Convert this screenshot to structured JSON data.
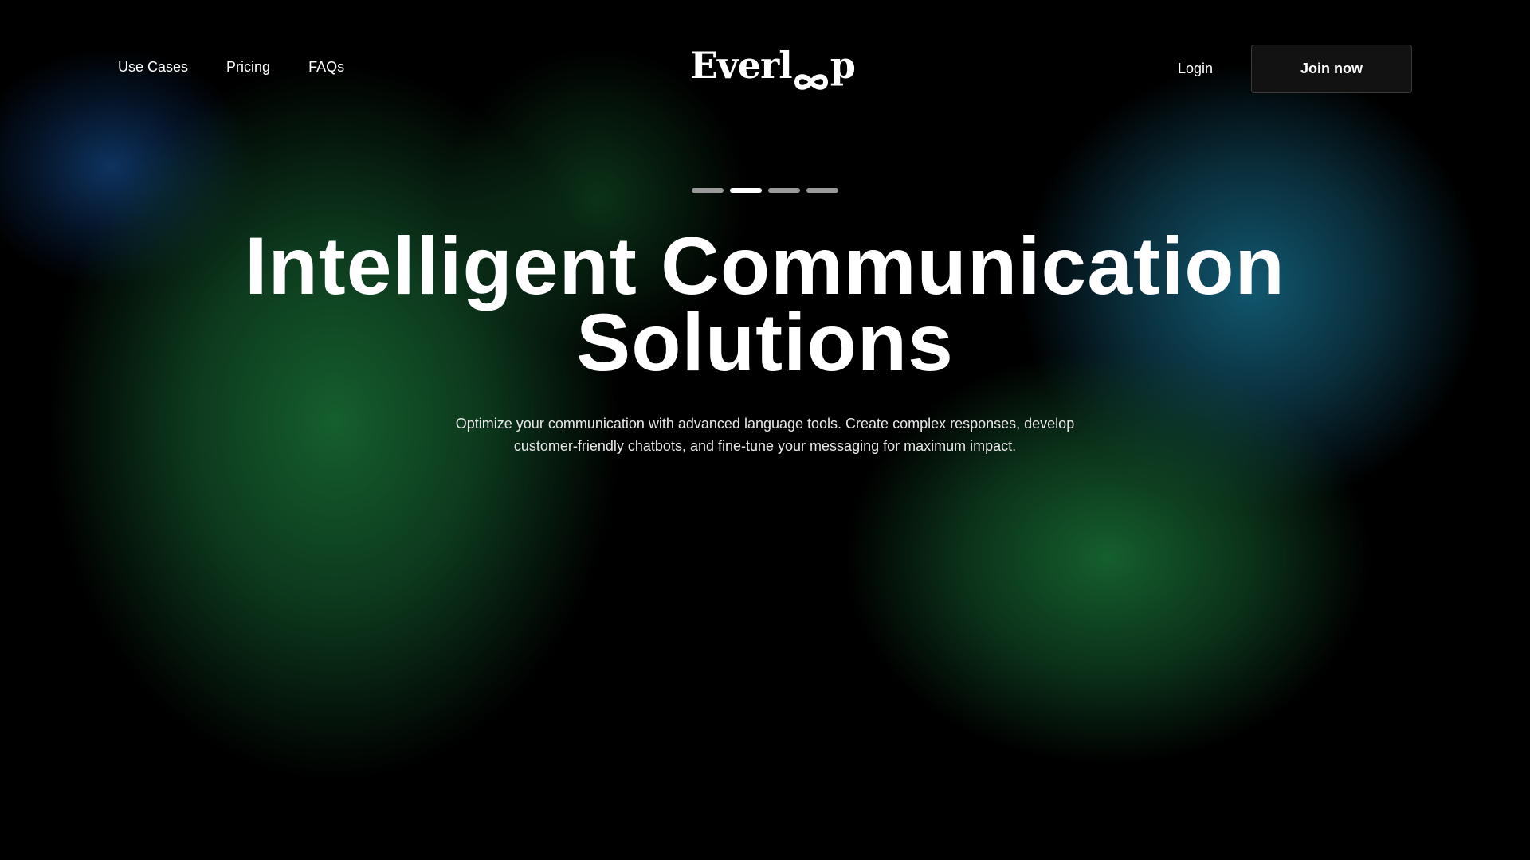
{
  "nav": {
    "links": [
      "Use Cases",
      "Pricing",
      "FAQs"
    ],
    "login_label": "Login",
    "join_label": "Join now"
  },
  "brand": {
    "name_start": "Everl",
    "name_end": "p",
    "logo_icon": "infinity-icon"
  },
  "hero": {
    "slides_total": 4,
    "active_slide": 2,
    "title_line1": "Intelligent Communication",
    "title_line2": "Solutions",
    "subtitle": "Optimize your communication with advanced language tools. Create complex responses, develop customer-friendly chatbots, and fine-tune your messaging for maximum impact."
  },
  "colors": {
    "background": "#000000",
    "glow_green": "#16642f",
    "glow_teal": "#125c76",
    "glow_blue": "#0e3664",
    "button_bg": "#121212"
  }
}
